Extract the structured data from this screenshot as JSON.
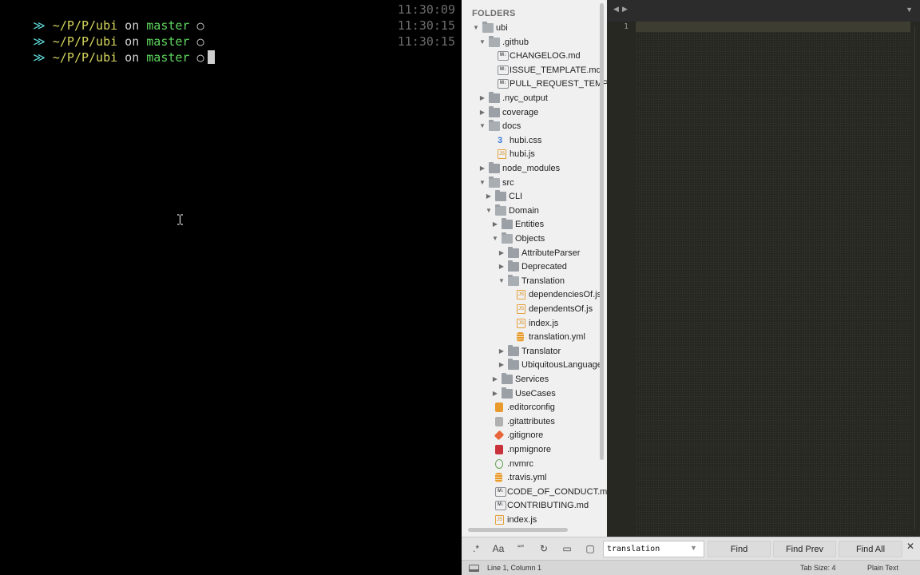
{
  "terminal": {
    "lines": [
      {
        "prompt": "≫",
        "path": "~/P/P/ubi",
        "on": "on",
        "branch": "master",
        "status": "○",
        "time": "11:30:09",
        "cursor": false
      },
      {
        "prompt": "≫",
        "path": "~/P/P/ubi",
        "on": "on",
        "branch": "master",
        "status": "○",
        "time": "11:30:15",
        "cursor": false
      },
      {
        "prompt": "≫",
        "path": "~/P/P/ubi",
        "on": "on",
        "branch": "master",
        "status": "○",
        "time": "11:30:15",
        "cursor": true
      }
    ]
  },
  "sidebar": {
    "header": "FOLDERS",
    "items": [
      {
        "label": "ubi",
        "type": "folder",
        "open": true,
        "depth": 0
      },
      {
        "label": ".github",
        "type": "folder",
        "open": true,
        "depth": 1
      },
      {
        "label": "CHANGELOG.md",
        "type": "md",
        "depth": 2
      },
      {
        "label": "ISSUE_TEMPLATE.md",
        "type": "md",
        "depth": 2
      },
      {
        "label": "PULL_REQUEST_TEMPLATE.md",
        "type": "md",
        "depth": 2
      },
      {
        "label": ".nyc_output",
        "type": "folder",
        "open": false,
        "depth": 1
      },
      {
        "label": "coverage",
        "type": "folder",
        "open": false,
        "depth": 1
      },
      {
        "label": "docs",
        "type": "folder",
        "open": true,
        "depth": 1
      },
      {
        "label": "hubi.css",
        "type": "css",
        "depth": 2
      },
      {
        "label": "hubi.js",
        "type": "js",
        "depth": 2
      },
      {
        "label": "node_modules",
        "type": "folder",
        "open": false,
        "depth": 1
      },
      {
        "label": "src",
        "type": "folder",
        "open": true,
        "depth": 1
      },
      {
        "label": "CLI",
        "type": "folder",
        "open": false,
        "depth": 2
      },
      {
        "label": "Domain",
        "type": "folder",
        "open": true,
        "depth": 2
      },
      {
        "label": "Entities",
        "type": "folder",
        "open": false,
        "depth": 3
      },
      {
        "label": "Objects",
        "type": "folder",
        "open": true,
        "depth": 3
      },
      {
        "label": "AttributeParser",
        "type": "folder",
        "open": false,
        "depth": 4
      },
      {
        "label": "Deprecated",
        "type": "folder",
        "open": false,
        "depth": 4
      },
      {
        "label": "Translation",
        "type": "folder",
        "open": true,
        "depth": 4
      },
      {
        "label": "dependenciesOf.js",
        "type": "js",
        "depth": 5
      },
      {
        "label": "dependentsOf.js",
        "type": "js",
        "depth": 5
      },
      {
        "label": "index.js",
        "type": "js",
        "depth": 5
      },
      {
        "label": "translation.yml",
        "type": "yml",
        "depth": 5
      },
      {
        "label": "Translator",
        "type": "folder",
        "open": false,
        "depth": 4
      },
      {
        "label": "UbiquitousLanguage",
        "type": "folder",
        "open": false,
        "depth": 4
      },
      {
        "label": "Services",
        "type": "folder",
        "open": false,
        "depth": 3
      },
      {
        "label": "UseCases",
        "type": "folder",
        "open": false,
        "depth": 3
      },
      {
        "label": ".editorconfig",
        "type": "editorconfig",
        "depth": 1
      },
      {
        "label": ".gitattributes",
        "type": "generic",
        "depth": 1
      },
      {
        "label": ".gitignore",
        "type": "git",
        "depth": 1
      },
      {
        "label": ".npmignore",
        "type": "npm",
        "depth": 1
      },
      {
        "label": ".nvmrc",
        "type": "node",
        "depth": 1
      },
      {
        "label": ".travis.yml",
        "type": "yml",
        "depth": 1
      },
      {
        "label": "CODE_OF_CONDUCT.md",
        "type": "md",
        "depth": 1
      },
      {
        "label": "CONTRIBUTING.md",
        "type": "md",
        "depth": 1
      },
      {
        "label": "index.js",
        "type": "js",
        "depth": 1
      }
    ]
  },
  "editor": {
    "nav_back": "◀",
    "nav_forward": "▶",
    "tab_menu": "▼",
    "line_number": "1"
  },
  "find": {
    "regex": ".*",
    "case": "Aa",
    "whole_word": "“”",
    "wrap": "↻",
    "in_selection": "▭",
    "highlight": "▢",
    "query": "translation",
    "history": "▼",
    "find_label": "Find",
    "find_prev_label": "Find Prev",
    "find_all_label": "Find All",
    "close": "✕"
  },
  "status": {
    "position": "Line 1, Column 1",
    "tab_size": "Tab Size: 4",
    "syntax": "Plain Text"
  },
  "colors": {
    "terminal_bg": "#000000",
    "prompt": "#5fd7d7",
    "path": "#d7d75f",
    "branch": "#5fd75f",
    "sidebar_bg": "#f0f0f0",
    "editor_bg": "#272822"
  }
}
